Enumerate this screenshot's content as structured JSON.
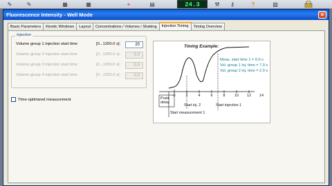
{
  "window": {
    "title": "Fluorescence Intensity  -  Well Mode",
    "close_glyph": "×"
  },
  "toolbar": {
    "display_value": "24.3",
    "icons": [
      "pipette-icon",
      "pipette-icon",
      "plate-icon",
      "plate-icon",
      "crosshair-icon",
      "chart-icon",
      "tools-icon",
      "key-icon",
      "help-icon",
      "lock-icon"
    ]
  },
  "tabs": [
    {
      "label": "Basic Parameters"
    },
    {
      "label": "Kinetic Windows"
    },
    {
      "label": "Layout"
    },
    {
      "label": "Concentrations / Volumes / Shaking"
    },
    {
      "label": "Injection Timing"
    },
    {
      "label": "Timing Overview"
    }
  ],
  "active_tab_index": 4,
  "injection": {
    "legend": "Injection",
    "rows": [
      {
        "label": "Volume group 1 injection start time",
        "range": "[0...1200.0 s]:",
        "value": "20",
        "enabled": true
      },
      {
        "label": "Volume group 2 injection start time",
        "range": "[0...1200.0 s]:",
        "value": "0.0",
        "enabled": false
      },
      {
        "label": "Volume group 3 injection start time",
        "range": "[0...1200.0 s]:",
        "value": "0.0",
        "enabled": false
      },
      {
        "label": "Volume group 4 injection start time",
        "range": "[0...1200.0 s]:",
        "value": "0.0",
        "enabled": false
      }
    ]
  },
  "time_optimized": {
    "label": "Time-optimized measurement",
    "checked": false
  },
  "timing_example": {
    "title": "Timing Example:",
    "legend_lines": [
      "Meas. start time 1 = 0.0 s",
      "Vol. group 1 inj. time = 7.0 s",
      "Vol. group 2 inj. time = 2.0 s"
    ],
    "axis_ticks": [
      "0",
      "2",
      "4",
      "6",
      "8",
      "10",
      "12",
      "14"
    ],
    "posit_delay": "Posit.\ndelay",
    "start_inj2": "Start inj. 2",
    "start_inj1": "Start injection 1",
    "start_meas1": "Start measurement 1"
  }
}
